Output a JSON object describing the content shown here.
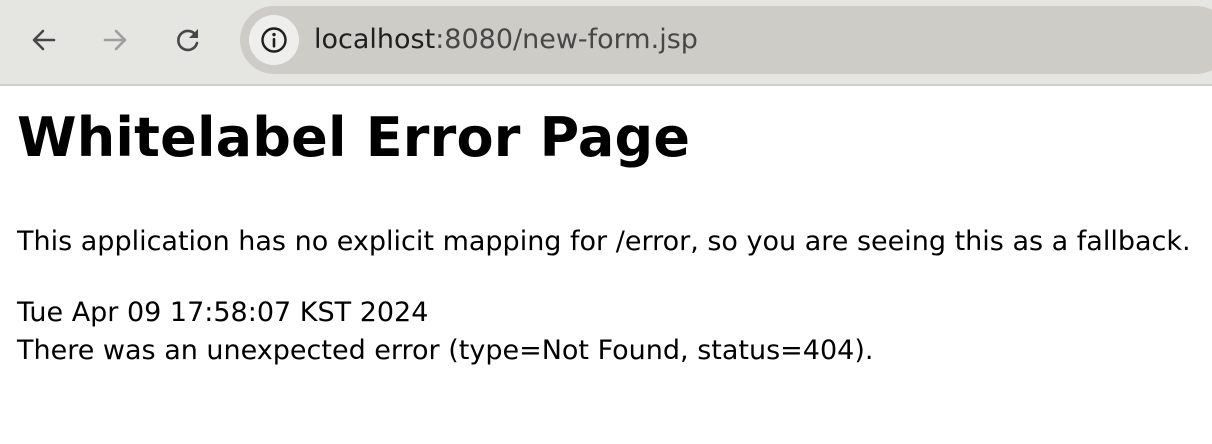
{
  "browser": {
    "url_host": "localhost",
    "url_rest": ":8080/new-form.jsp",
    "icons": {
      "back": "arrow-left-icon",
      "forward": "arrow-right-icon",
      "reload": "reload-icon",
      "site_info": "info-icon"
    }
  },
  "page": {
    "title": "Whitelabel Error Page",
    "message": "This application has no explicit mapping for /error, so you are seeing this as a fallback.",
    "timestamp": "Tue Apr 09 17:58:07 KST 2024",
    "error_detail": "There was an unexpected error (type=Not Found, status=404)."
  }
}
